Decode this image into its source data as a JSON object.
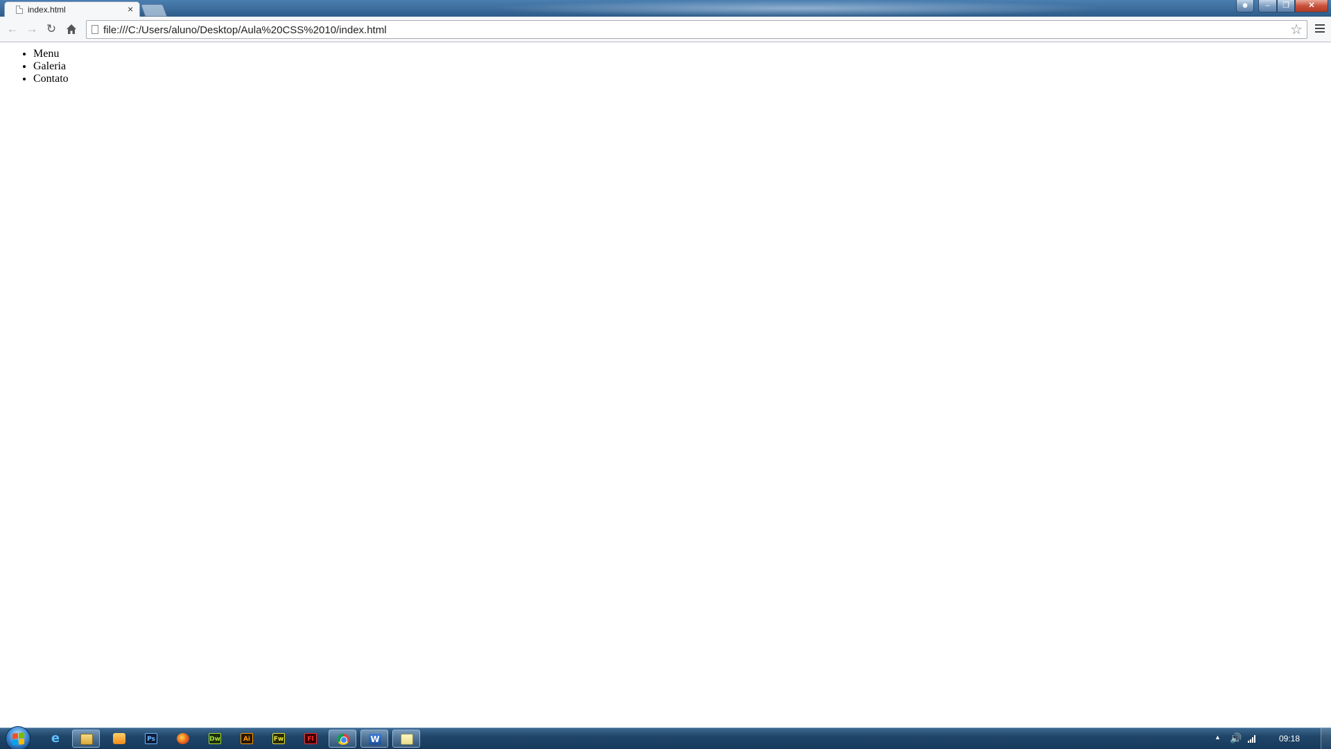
{
  "browser": {
    "tab_title": "index.html",
    "tab_close": "×",
    "address_url": "file:///C:/Users/aluno/Desktop/Aula%20CSS%2010/index.html"
  },
  "page": {
    "menu_items": [
      "Menu",
      "Galeria",
      "Contato"
    ]
  },
  "taskbar": {
    "apps": [
      {
        "name": "internet-explorer",
        "label": "e"
      },
      {
        "name": "windows-explorer",
        "label": ""
      },
      {
        "name": "media-player",
        "label": ""
      },
      {
        "name": "photoshop",
        "label": "Ps"
      },
      {
        "name": "firefox",
        "label": ""
      },
      {
        "name": "dreamweaver",
        "label": "Dw"
      },
      {
        "name": "illustrator",
        "label": "Ai"
      },
      {
        "name": "fireworks",
        "label": "Fw"
      },
      {
        "name": "flash",
        "label": "Fl"
      },
      {
        "name": "chrome",
        "label": ""
      },
      {
        "name": "word",
        "label": "W"
      },
      {
        "name": "notepad",
        "label": ""
      }
    ],
    "clock": "09:18"
  },
  "icons": {
    "back": "back-arrow-icon",
    "forward": "forward-arrow-icon",
    "reload": "reload-icon",
    "home": "home-icon",
    "star": "star-icon",
    "menu": "hamburger-menu-icon"
  },
  "colors": {
    "taskbar": "#1f4568",
    "titlebar": "#3f6f9e",
    "toolbar": "#f6f7f9"
  }
}
